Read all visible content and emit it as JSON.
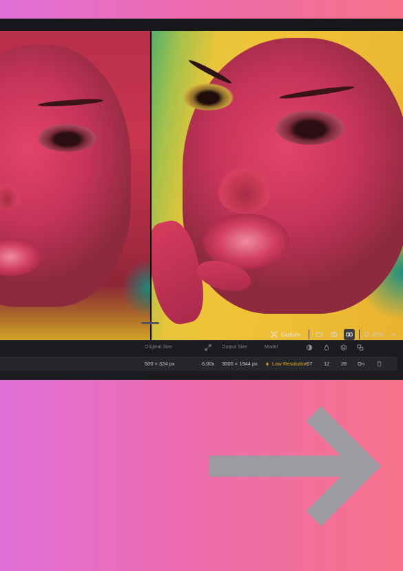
{
  "toolbar": {
    "capture_label": "Capture",
    "zoom_label": "87%"
  },
  "table": {
    "headers": {
      "original_size": "Original Size",
      "output_size": "Output Size",
      "model": "Model"
    },
    "row": {
      "original_size": "500 × 324 px",
      "scale": "6.00x",
      "output_size": "3000 × 1944 px",
      "model": "Low Resolution",
      "value_1": "57",
      "value_2": "12",
      "value_3": "28",
      "value_4": "On"
    }
  },
  "colors": {
    "accent_model": "#e6a91a",
    "background_gradient_start": "#e070d8",
    "background_gradient_end": "#f6728a",
    "panel": "#1b1c1f"
  }
}
